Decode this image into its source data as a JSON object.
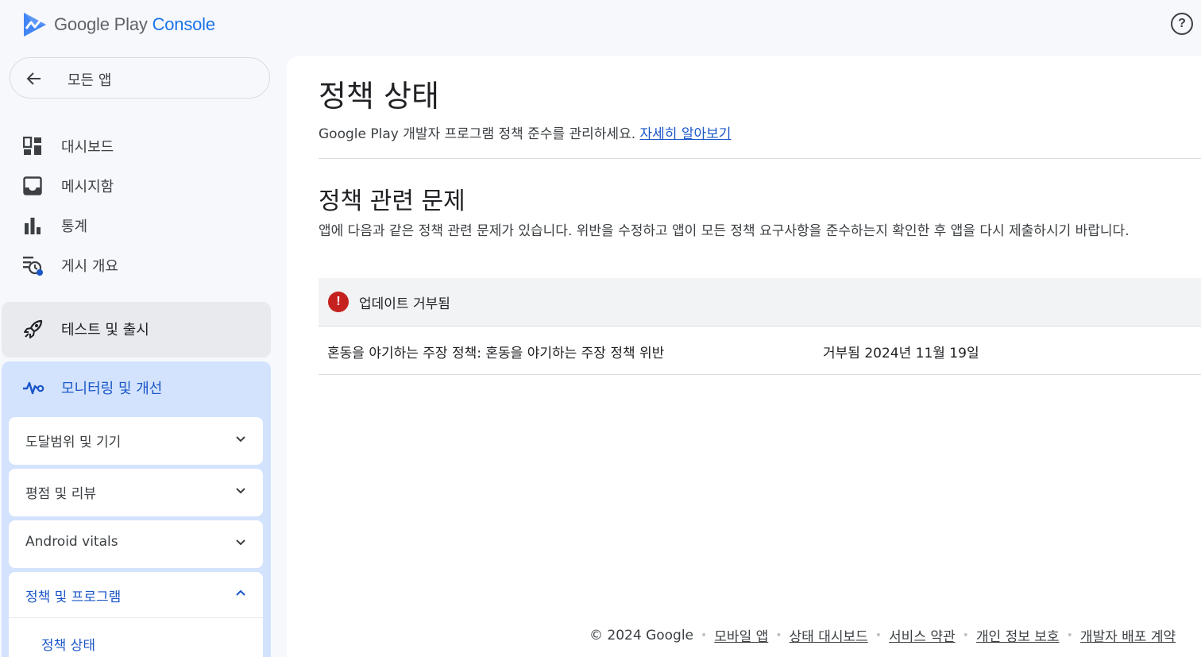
{
  "app": {
    "brand_google_play": "Google Play",
    "brand_console": "Console",
    "help_symbol": "?"
  },
  "sidebar": {
    "back_label": "모든 앱",
    "items": [
      {
        "label": "대시보드",
        "icon": "dashboard-icon"
      },
      {
        "label": "메시지함",
        "icon": "inbox-icon"
      },
      {
        "label": "통계",
        "icon": "bar-chart-icon"
      },
      {
        "label": "게시 개요",
        "icon": "publishing-overview-icon"
      }
    ],
    "test_release": {
      "label": "테스트 및 출시",
      "icon": "rocket-icon"
    },
    "monitor": {
      "label": "모니터링 및 개선",
      "icon": "vitals-pulse-icon",
      "subsections": [
        {
          "label": "도달범위 및 기기",
          "expanded": false
        },
        {
          "label": "평점 및 리뷰",
          "expanded": false
        },
        {
          "label": "Android vitals",
          "expanded": false
        }
      ],
      "policy": {
        "label": "정책 및 프로그램",
        "expanded": true,
        "child": "정책 상태"
      }
    }
  },
  "main": {
    "title": "정책 상태",
    "subtitle": "Google Play 개발자 프로그램 정책 준수를 관리하세요.",
    "learn_more": "자세히 알아보기",
    "issues_title": "정책 관련 문제",
    "issues_description": "앱에 다음과 같은 정책 관련 문제가 있습니다. 위반을 수정하고 앱이 모든 정책 요구사항을 준수하는지 확인한 후 앱을 다시 제출하시기 바랍니다.",
    "issue_group": {
      "icon_symbol": "!",
      "label": "업데이트 거부됨",
      "rows": [
        {
          "name": "혼동을 야기하는 주장 정책: 혼동을 야기하는 주장 정책 위반",
          "status": "거부됨 2024년 11월 19일"
        }
      ]
    }
  },
  "footer": {
    "copyright": "© 2024 Google",
    "links": [
      "모바일 앱",
      "상태 대시보드",
      "서비스 약관",
      "개인 정보 보호",
      "개발자 배포 계약"
    ]
  },
  "colors": {
    "accent_blue": "#1a56c8",
    "active_section_bg": "#d3e3fd",
    "error_red": "#c5221f"
  }
}
